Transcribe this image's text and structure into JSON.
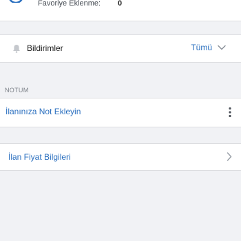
{
  "stats": {
    "favorites_label": "Favoriye Eklenme:",
    "favorites_value": "0"
  },
  "notifications": {
    "label": "Bildirimler",
    "filter_value": "Tümü",
    "icons": {
      "bell": "bell-icon",
      "dropdown": "chevron-down-icon"
    }
  },
  "notes": {
    "section_title": "NOTUM",
    "add_note_label": "İlanınıza Not Ekleyin",
    "icons": {
      "menu": "more-vertical-icon"
    }
  },
  "price_info": {
    "label": "İlan Fiyat Bilgileri",
    "icons": {
      "arrow": "chevron-right-icon"
    }
  },
  "colors": {
    "accent": "#2a6fbf",
    "background": "#f1f2f5",
    "card": "#ffffff",
    "divider": "#dcdde0"
  }
}
